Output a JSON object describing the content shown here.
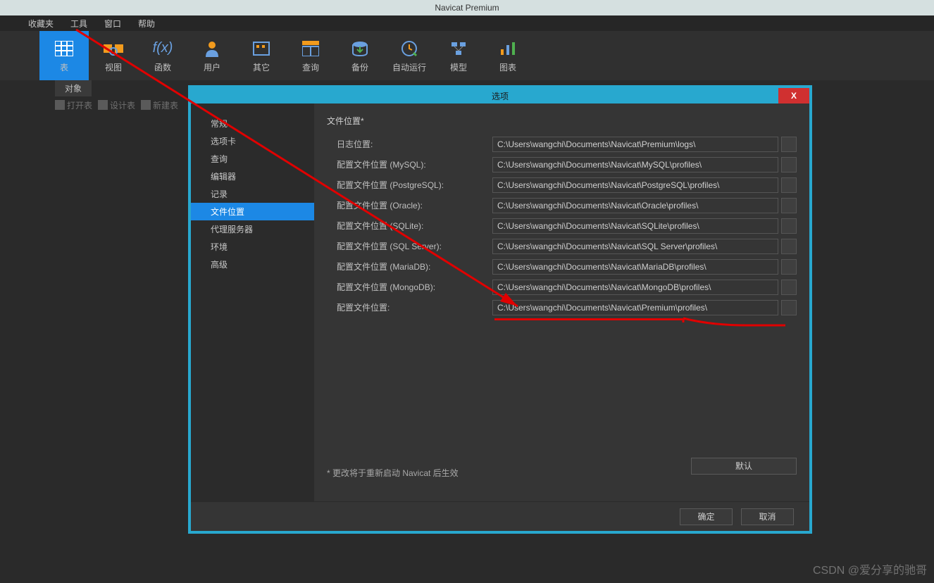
{
  "app_title": "Navicat Premium",
  "menu": [
    "",
    "收藏夹",
    "工具",
    "窗口",
    "帮助"
  ],
  "toolbar": [
    {
      "label": "表",
      "active": true
    },
    {
      "label": "视图"
    },
    {
      "label": "函数"
    },
    {
      "label": "用户"
    },
    {
      "label": "其它"
    },
    {
      "label": "查询"
    },
    {
      "label": "备份"
    },
    {
      "label": "自动运行"
    },
    {
      "label": "模型"
    },
    {
      "label": "图表"
    }
  ],
  "sub_tab": "对象",
  "sub_toolbar": [
    "打开表",
    "设计表",
    "新建表"
  ],
  "dialog": {
    "title": "选项",
    "close": "X",
    "sidebar": [
      "常规",
      "选项卡",
      "查询",
      "编辑器",
      "记录",
      "文件位置",
      "代理服务器",
      "环境",
      "高级"
    ],
    "sidebar_selected": 5,
    "section_title": "文件位置*",
    "rows": [
      {
        "label": "日志位置:",
        "value": "C:\\Users\\wangchi\\Documents\\Navicat\\Premium\\logs\\"
      },
      {
        "label": "配置文件位置 (MySQL):",
        "value": "C:\\Users\\wangchi\\Documents\\Navicat\\MySQL\\profiles\\"
      },
      {
        "label": "配置文件位置 (PostgreSQL):",
        "value": "C:\\Users\\wangchi\\Documents\\Navicat\\PostgreSQL\\profiles\\"
      },
      {
        "label": "配置文件位置 (Oracle):",
        "value": "C:\\Users\\wangchi\\Documents\\Navicat\\Oracle\\profiles\\"
      },
      {
        "label": "配置文件位置 (SQLite):",
        "value": "C:\\Users\\wangchi\\Documents\\Navicat\\SQLite\\profiles\\"
      },
      {
        "label": "配置文件位置 (SQL Server):",
        "value": "C:\\Users\\wangchi\\Documents\\Navicat\\SQL Server\\profiles\\"
      },
      {
        "label": "配置文件位置 (MariaDB):",
        "value": "C:\\Users\\wangchi\\Documents\\Navicat\\MariaDB\\profiles\\"
      },
      {
        "label": "配置文件位置 (MongoDB):",
        "value": "C:\\Users\\wangchi\\Documents\\Navicat\\MongoDB\\profiles\\"
      },
      {
        "label": "配置文件位置:",
        "value": "C:\\Users\\wangchi\\Documents\\Navicat\\Premium\\profiles\\"
      }
    ],
    "note": "* 更改将于重新启动 Navicat 后生效",
    "default_btn": "默认",
    "ok_btn": "确定",
    "cancel_btn": "取消"
  },
  "watermark": "CSDN @爱分享的驰哥"
}
